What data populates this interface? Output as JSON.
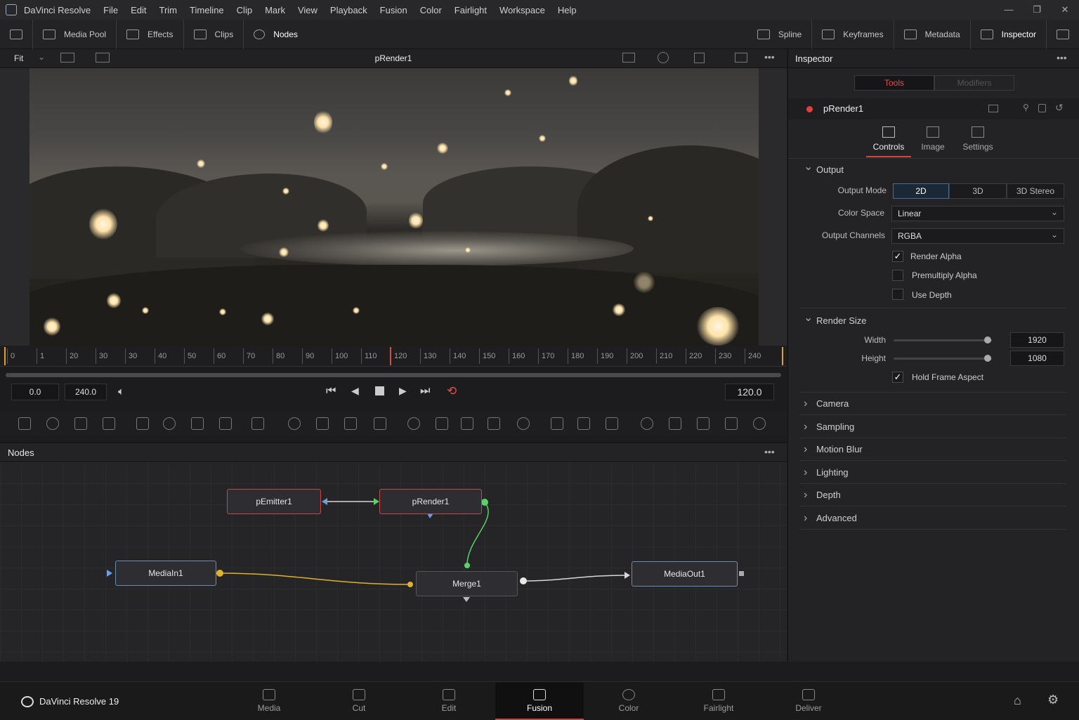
{
  "menu": {
    "app": "DaVinci Resolve",
    "items": [
      "File",
      "Edit",
      "Trim",
      "Timeline",
      "Clip",
      "Mark",
      "View",
      "Playback",
      "Fusion",
      "Color",
      "Fairlight",
      "Workspace",
      "Help"
    ]
  },
  "toolbar": {
    "left": [
      "Media Pool",
      "Effects",
      "Clips",
      "Nodes"
    ],
    "right": [
      "Spline",
      "Keyframes",
      "Metadata",
      "Inspector"
    ]
  },
  "viewer": {
    "zoom": "Fit",
    "title": "pRender1"
  },
  "ruler": {
    "ticks": [
      "0",
      "1",
      "20",
      "30",
      "30",
      "40",
      "50",
      "60",
      "70",
      "80",
      "90",
      "100",
      "110",
      "120",
      "130",
      "140",
      "150",
      "160",
      "170",
      "180",
      "190",
      "200",
      "210",
      "220",
      "230",
      "240"
    ]
  },
  "transport": {
    "start": "0.0",
    "end": "240.0",
    "current": "120.0"
  },
  "nodes": {
    "title": "Nodes",
    "items": {
      "pemitter": "pEmitter1",
      "prender": "pRender1",
      "mediain": "MediaIn1",
      "merge": "Merge1",
      "mediaout": "MediaOut1"
    }
  },
  "inspector": {
    "title": "Inspector",
    "tab_tools": "Tools",
    "tab_modifiers": "Modifiers",
    "node": "pRender1",
    "subtabs": [
      "Controls",
      "Image",
      "Settings"
    ],
    "output": {
      "header": "Output",
      "mode_label": "Output Mode",
      "modes": [
        "2D",
        "3D",
        "3D Stereo"
      ],
      "cs_label": "Color Space",
      "cs_value": "Linear",
      "ch_label": "Output Channels",
      "ch_value": "RGBA",
      "render_alpha": "Render Alpha",
      "premult": "Premultiply Alpha",
      "use_depth": "Use Depth"
    },
    "render_size": {
      "header": "Render Size",
      "width_label": "Width",
      "width": "1920",
      "height_label": "Height",
      "height": "1080",
      "hold": "Hold Frame Aspect"
    },
    "sections": [
      "Camera",
      "Sampling",
      "Motion Blur",
      "Lighting",
      "Depth",
      "Advanced"
    ]
  },
  "pagebar": {
    "brand": "DaVinci Resolve 19",
    "pages": [
      "Media",
      "Cut",
      "Edit",
      "Fusion",
      "Color",
      "Fairlight",
      "Deliver"
    ]
  }
}
